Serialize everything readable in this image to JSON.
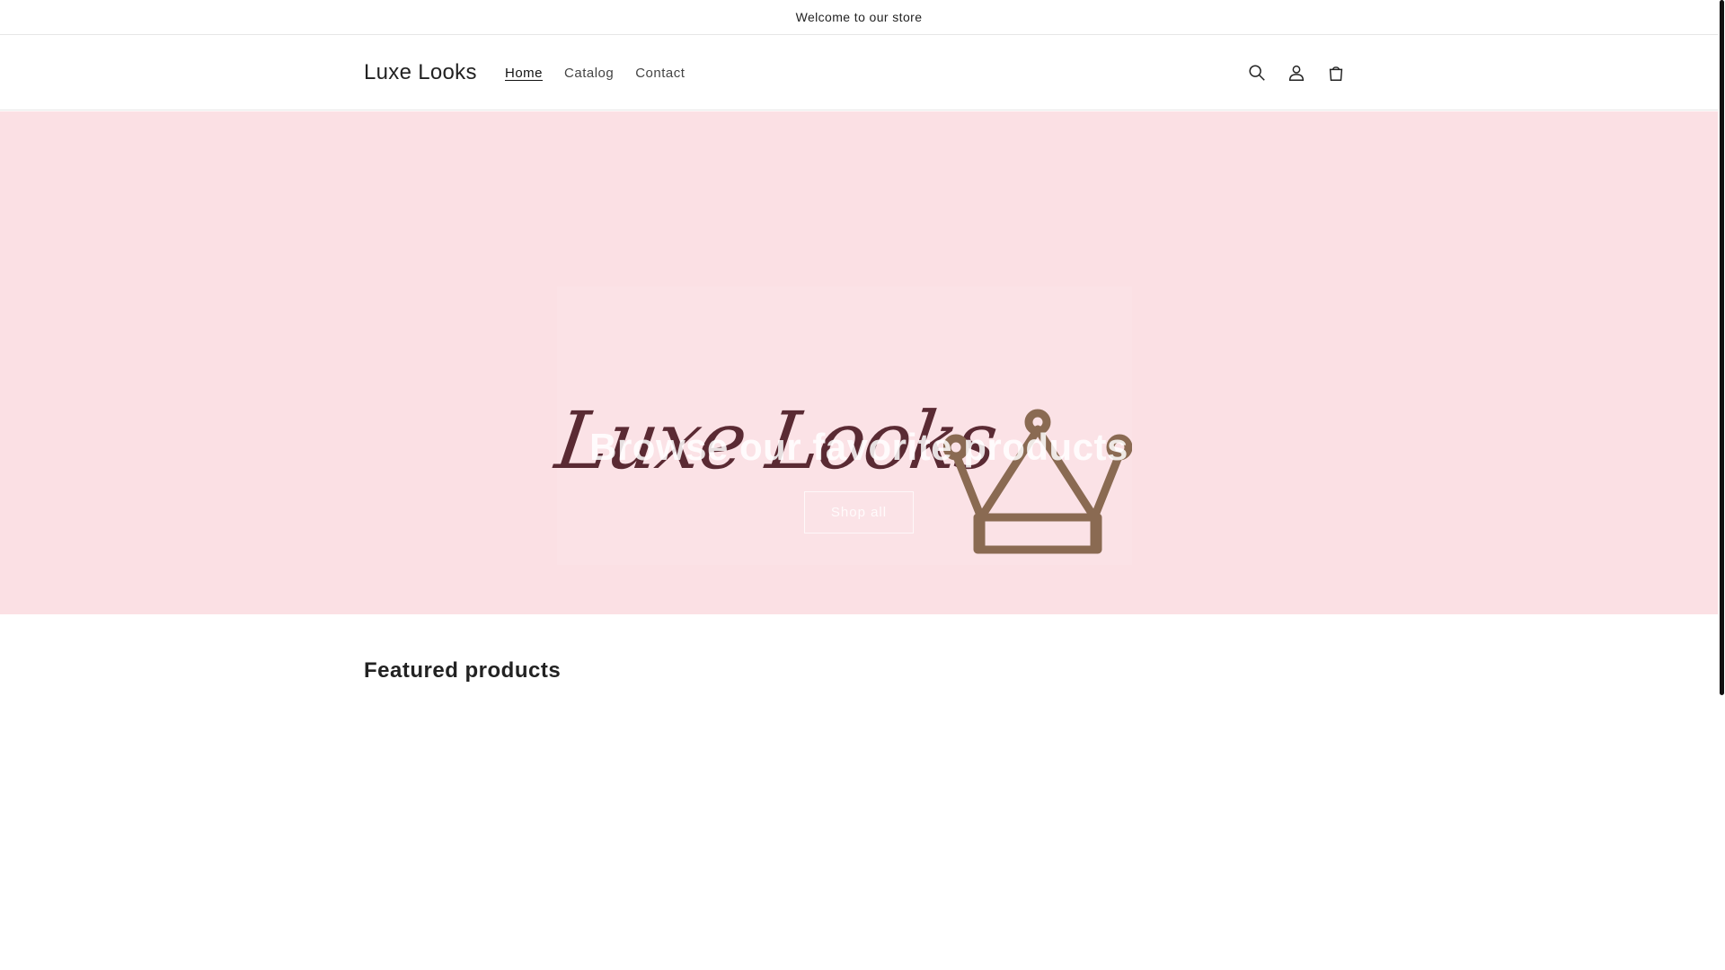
{
  "announcement": {
    "text": "Welcome to our store"
  },
  "header": {
    "logo_text": "Luxe Looks",
    "nav": [
      {
        "label": "Home",
        "active": true
      },
      {
        "label": "Catalog",
        "active": false
      },
      {
        "label": "Contact",
        "active": false
      }
    ],
    "icons": [
      "search-icon",
      "account-icon",
      "cart-icon"
    ]
  },
  "hero": {
    "logo_script": "Luxe Looks",
    "heading": "Browse our favorite products",
    "button_label": "Shop all",
    "background_color": "#fbe0e4"
  },
  "featured": {
    "title": "Featured products"
  }
}
